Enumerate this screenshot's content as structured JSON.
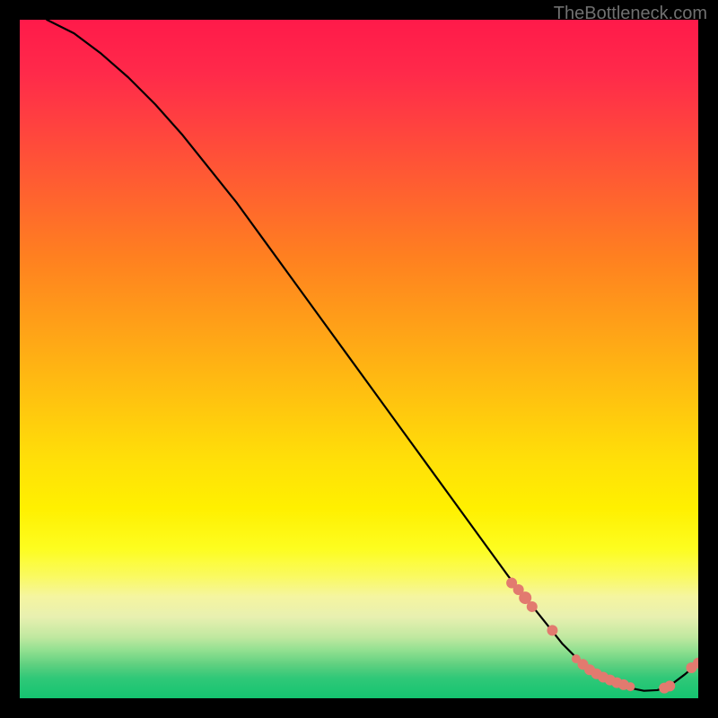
{
  "watermark": "TheBottleneck.com",
  "chart_data": {
    "type": "line",
    "title": "",
    "xlabel": "",
    "ylabel": "",
    "xlim": [
      0,
      100
    ],
    "ylim": [
      0,
      100
    ],
    "grid": false,
    "series": [
      {
        "name": "bottleneck-curve",
        "color": "#000000",
        "x": [
          4,
          8,
          12,
          16,
          20,
          24,
          28,
          32,
          36,
          40,
          44,
          48,
          52,
          56,
          60,
          64,
          68,
          72,
          74,
          76,
          78,
          80,
          82,
          84,
          86,
          88,
          90,
          92,
          94,
          96,
          98,
          100
        ],
        "y": [
          100,
          98,
          95,
          91.5,
          87.5,
          83,
          78,
          73,
          67.5,
          62,
          56.5,
          51,
          45.5,
          40,
          34.5,
          29,
          23.5,
          18,
          15.5,
          13,
          10.5,
          8,
          6,
          4.5,
          3.2,
          2.2,
          1.5,
          1.1,
          1.2,
          2.0,
          3.5,
          5.2
        ]
      }
    ],
    "markers": [
      {
        "x": 72.5,
        "y": 17.0,
        "size": 6
      },
      {
        "x": 73.5,
        "y": 16.0,
        "size": 6
      },
      {
        "x": 74.5,
        "y": 14.8,
        "size": 7
      },
      {
        "x": 75.5,
        "y": 13.5,
        "size": 6
      },
      {
        "x": 78.5,
        "y": 10.0,
        "size": 6
      },
      {
        "x": 82.0,
        "y": 5.8,
        "size": 5
      },
      {
        "x": 83.0,
        "y": 5.0,
        "size": 6
      },
      {
        "x": 84.0,
        "y": 4.2,
        "size": 6
      },
      {
        "x": 85.0,
        "y": 3.6,
        "size": 6
      },
      {
        "x": 86.0,
        "y": 3.1,
        "size": 6
      },
      {
        "x": 87.0,
        "y": 2.7,
        "size": 6
      },
      {
        "x": 88.0,
        "y": 2.3,
        "size": 6
      },
      {
        "x": 89.0,
        "y": 2.0,
        "size": 6
      },
      {
        "x": 90.0,
        "y": 1.7,
        "size": 5
      },
      {
        "x": 95.0,
        "y": 1.5,
        "size": 6
      },
      {
        "x": 95.8,
        "y": 1.8,
        "size": 6
      },
      {
        "x": 99.0,
        "y": 4.5,
        "size": 6
      },
      {
        "x": 100.0,
        "y": 5.2,
        "size": 6
      }
    ],
    "marker_color": "#e27a6f",
    "gradient": {
      "top": "#ff1a4a",
      "mid": "#ffe000",
      "bottom": "#14c470"
    }
  }
}
